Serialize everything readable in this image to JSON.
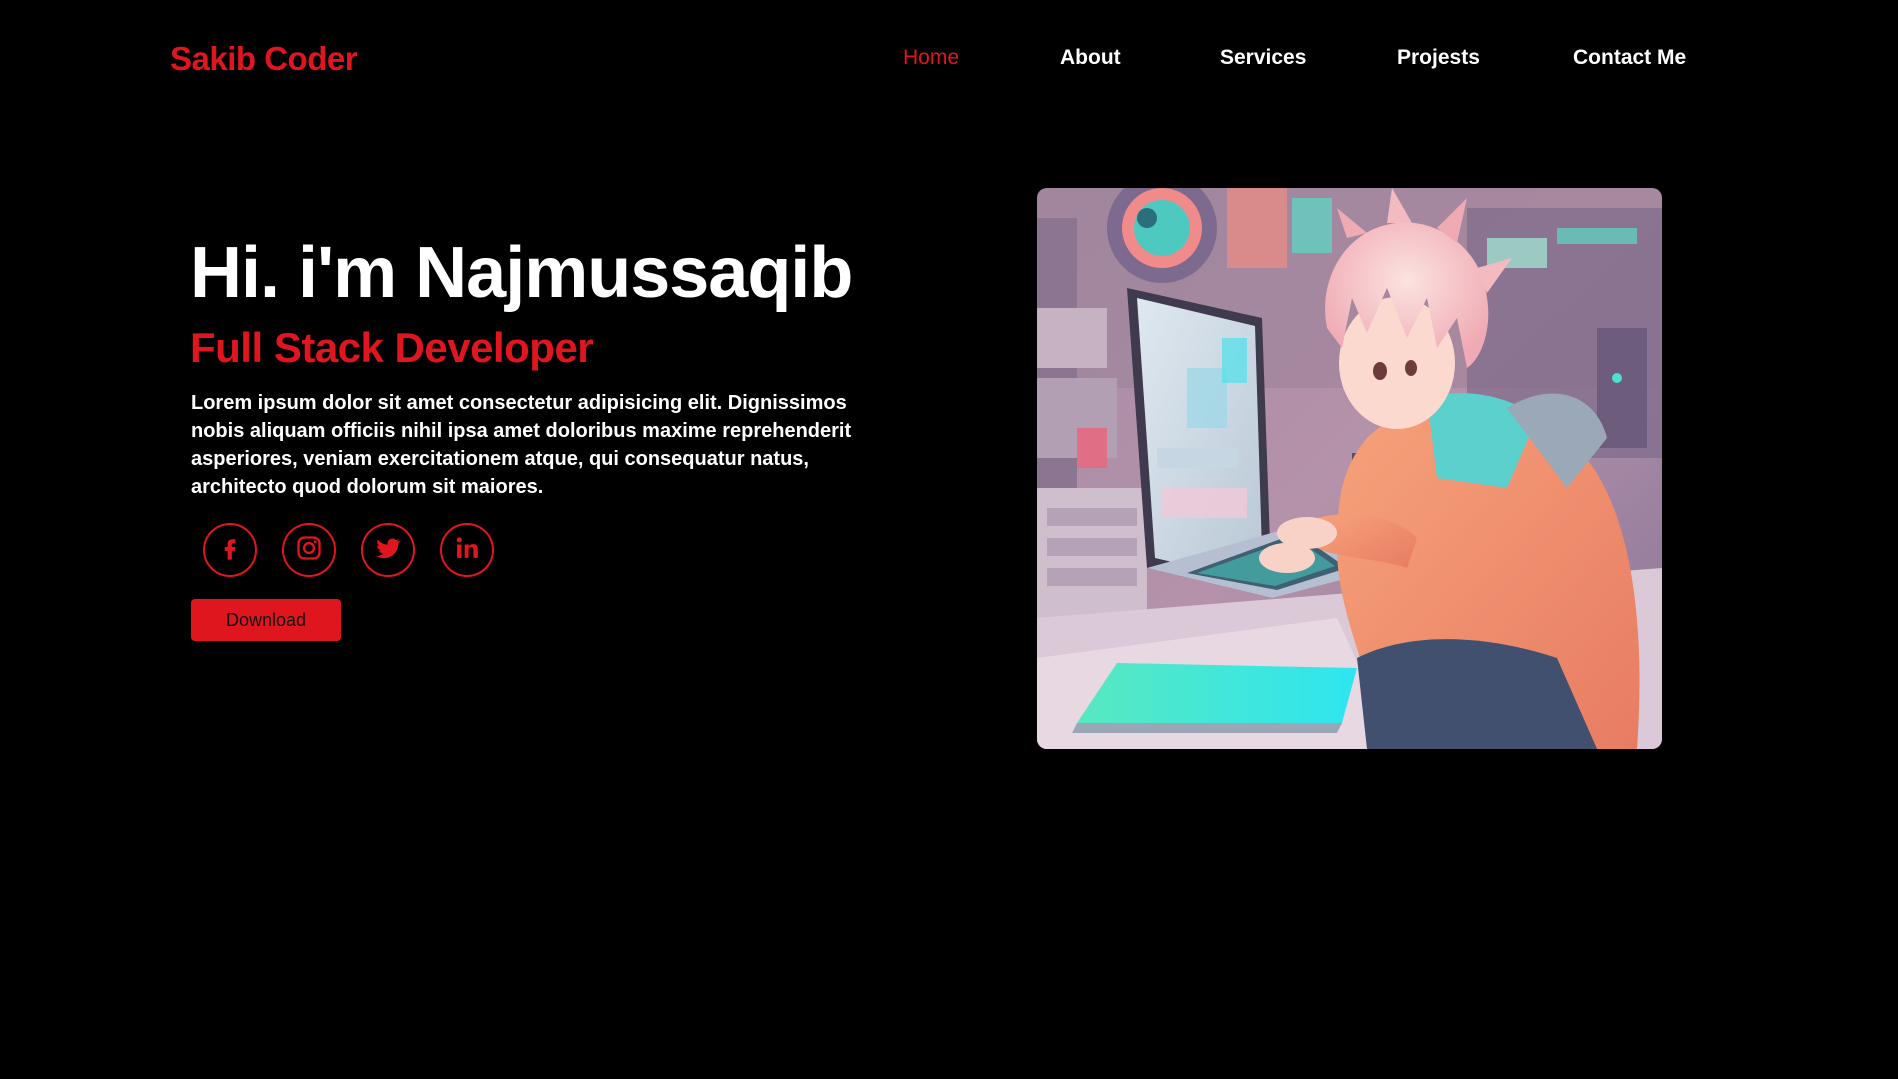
{
  "brand": {
    "logo": "Sakib Coder",
    "accent_color": "#e0161f",
    "background_color": "#000000"
  },
  "nav": {
    "home": "Home",
    "about": "About",
    "services": "Services",
    "projects": "Projests",
    "contact": "Contact Me",
    "active": "home"
  },
  "hero": {
    "title": "Hi. i'm Najmussaqib",
    "subtitle": "Full Stack Developer",
    "description": "Lorem ipsum dolor sit amet consectetur adipisicing elit. Dignissimos nobis aliquam officiis nihil ipsa amet doloribus maxime reprehenderit asperiores, veniam exercitationem atque, qui consequatur natus, architecto quod dolorum sit maiores.",
    "download_label": "Download"
  },
  "social": [
    {
      "name": "facebook",
      "icon": "facebook-icon"
    },
    {
      "name": "instagram",
      "icon": "instagram-icon"
    },
    {
      "name": "twitter",
      "icon": "twitter-icon"
    },
    {
      "name": "linkedin",
      "icon": "linkedin-icon"
    }
  ],
  "illustration": {
    "icon": "anime-developer-illustration"
  }
}
